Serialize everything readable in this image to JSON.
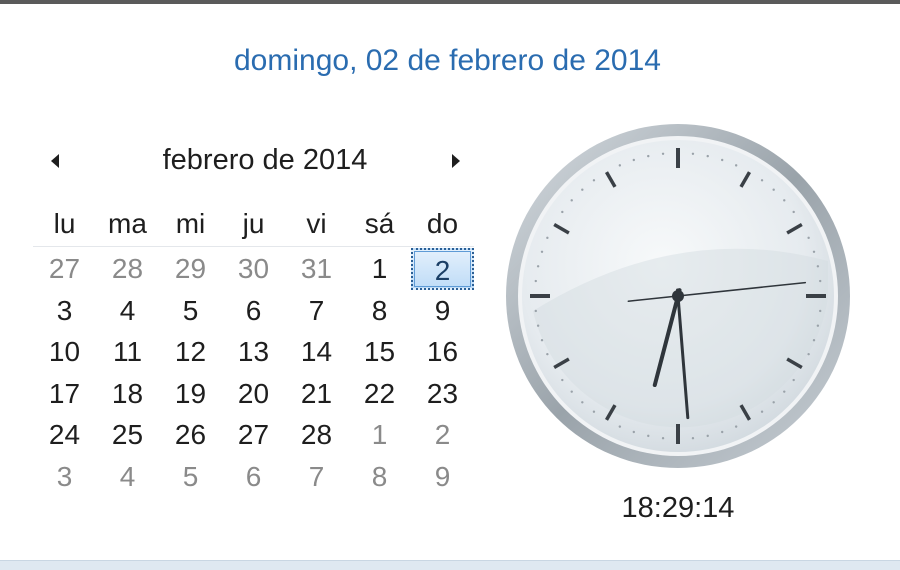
{
  "header": {
    "long_date": "domingo, 02 de febrero de 2014"
  },
  "calendar": {
    "month_title": "febrero de 2014",
    "prev_icon": "triangle-left-icon",
    "next_icon": "triangle-right-icon",
    "weekdays": [
      "lu",
      "ma",
      "mi",
      "ju",
      "vi",
      "sá",
      "do"
    ],
    "weeks": [
      [
        {
          "d": "27",
          "other": true
        },
        {
          "d": "28",
          "other": true
        },
        {
          "d": "29",
          "other": true
        },
        {
          "d": "30",
          "other": true
        },
        {
          "d": "31",
          "other": true
        },
        {
          "d": "1"
        },
        {
          "d": "2",
          "selected": true
        }
      ],
      [
        {
          "d": "3"
        },
        {
          "d": "4"
        },
        {
          "d": "5"
        },
        {
          "d": "6"
        },
        {
          "d": "7"
        },
        {
          "d": "8"
        },
        {
          "d": "9"
        }
      ],
      [
        {
          "d": "10"
        },
        {
          "d": "11"
        },
        {
          "d": "12"
        },
        {
          "d": "13"
        },
        {
          "d": "14"
        },
        {
          "d": "15"
        },
        {
          "d": "16"
        }
      ],
      [
        {
          "d": "17"
        },
        {
          "d": "18"
        },
        {
          "d": "19"
        },
        {
          "d": "20"
        },
        {
          "d": "21"
        },
        {
          "d": "22"
        },
        {
          "d": "23"
        }
      ],
      [
        {
          "d": "24"
        },
        {
          "d": "25"
        },
        {
          "d": "26"
        },
        {
          "d": "27"
        },
        {
          "d": "28"
        },
        {
          "d": "1",
          "other": true
        },
        {
          "d": "2",
          "other": true
        }
      ],
      [
        {
          "d": "3",
          "other": true
        },
        {
          "d": "4",
          "other": true
        },
        {
          "d": "5",
          "other": true
        },
        {
          "d": "6",
          "other": true
        },
        {
          "d": "7",
          "other": true
        },
        {
          "d": "8",
          "other": true
        },
        {
          "d": "9",
          "other": true
        }
      ]
    ],
    "selected_color": "#bfdcf7"
  },
  "clock": {
    "time_text": "18:29:14",
    "hours": 18,
    "minutes": 29,
    "seconds": 14,
    "face_color": "#e8edf1",
    "rim_color": "#aeb6bd"
  },
  "colors": {
    "date_link": "#2a6cb0",
    "text": "#1e1e1e",
    "muted": "#8a8a8a"
  }
}
